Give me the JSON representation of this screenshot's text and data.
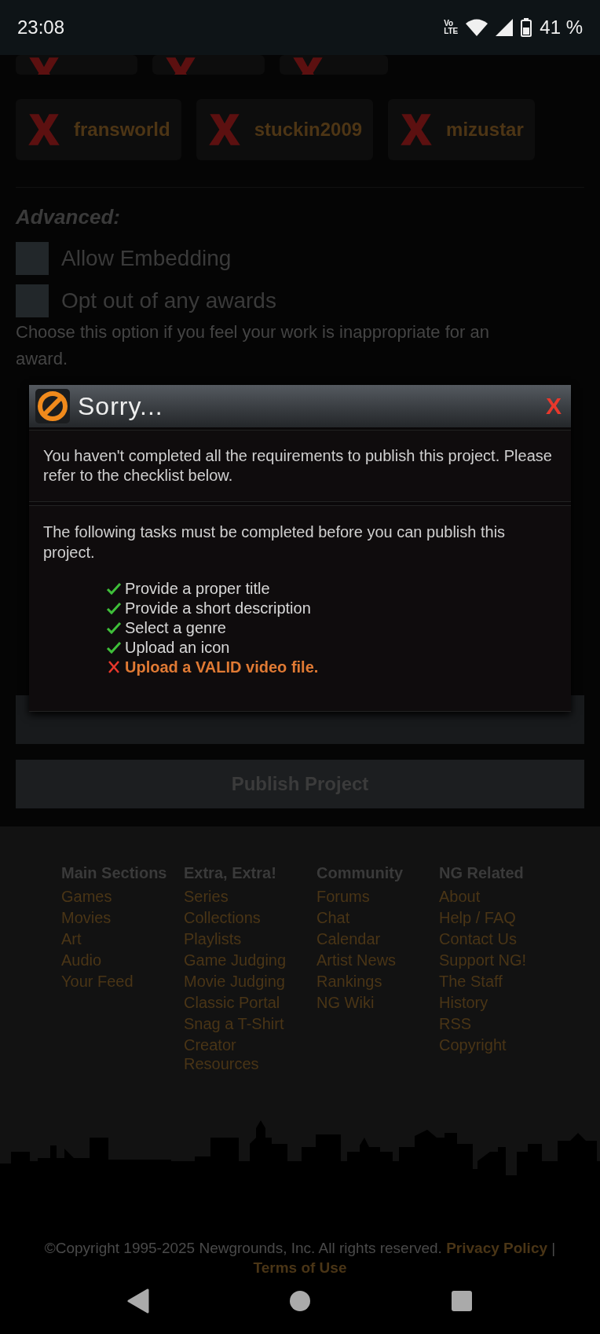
{
  "status_bar": {
    "time": "23:08",
    "network_top": "Vo",
    "network_bottom": "LTE",
    "battery": "41 %"
  },
  "collaborators": {
    "hidden_row": [
      {
        "kind": "card"
      },
      {
        "kind": "card"
      },
      {
        "kind": "card"
      }
    ],
    "cards": [
      {
        "name": "fransworld"
      },
      {
        "name": "stuckin2009"
      },
      {
        "name": "mizustar"
      }
    ]
  },
  "advanced": {
    "label": "Advanced:",
    "options": [
      {
        "label": "Allow Embedding",
        "checked": false
      },
      {
        "label": "Opt out of any awards",
        "checked": false
      }
    ],
    "note": "Choose this option if you feel your work is inappropriate for an award."
  },
  "buttons": {
    "publish": "Publish Project"
  },
  "dialog": {
    "title": "Sorry...",
    "close": "X",
    "message": "You haven't completed all the requirements to publish this project. Please refer to the checklist below.",
    "intro": "The following tasks must be completed before you can publish this project.",
    "tasks": [
      {
        "text": "Provide a proper title",
        "done": true
      },
      {
        "text": "Provide a short description",
        "done": true
      },
      {
        "text": "Select a genre",
        "done": true
      },
      {
        "text": "Upload an icon",
        "done": true
      },
      {
        "text": "Upload a VALID video file.",
        "done": false
      }
    ]
  },
  "footer": {
    "columns": [
      {
        "heading": "Main Sections",
        "links": [
          "Games",
          "Movies",
          "Art",
          "Audio",
          "Your Feed"
        ]
      },
      {
        "heading": "Extra, Extra!",
        "links": [
          "Series",
          "Collections",
          "Playlists",
          "Game Judging",
          "Movie Judging",
          "Classic Portal",
          "Snag a T-Shirt",
          "Creator Resources"
        ]
      },
      {
        "heading": "Community",
        "links": [
          "Forums",
          "Chat",
          "Calendar",
          "Artist News",
          "Rankings",
          "NG Wiki"
        ]
      },
      {
        "heading": "NG Related",
        "links": [
          "About",
          "Help / FAQ",
          "Contact Us",
          "Support NG!",
          "The Staff",
          "History",
          "RSS",
          "Copyright"
        ]
      }
    ],
    "copyright": "©Copyright 1995-2025 Newgrounds, Inc. All rights reserved.",
    "privacy": "Privacy Policy",
    "separator": "|",
    "terms": "Terms of Use"
  }
}
